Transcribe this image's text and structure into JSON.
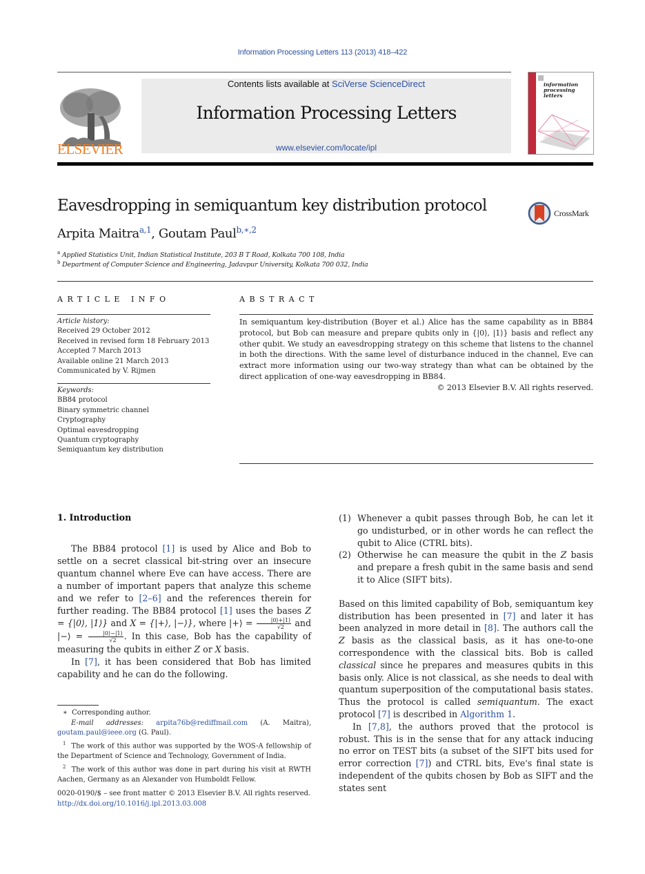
{
  "running_head": "Information Processing Letters 113 (2013) 418–422",
  "masthead": {
    "publisher": "ELSEVIER",
    "contents_prefix": "Contents lists available at ",
    "contents_link": "SciVerse ScienceDirect",
    "journal_title": "Information Processing Letters",
    "journal_url": "www.elsevier.com/locate/ipl",
    "cover_title_lines": [
      "information",
      "processing",
      "letters"
    ],
    "accent_color": "#f07f20",
    "cover_spine_color": "#c02a3b"
  },
  "article": {
    "title": "Eavesdropping in semiquantum key distribution protocol",
    "crossmark_label": "CrossMark",
    "authors": [
      {
        "name": "Arpita Maitra",
        "marks": "a,1"
      },
      {
        "name": "Goutam Paul",
        "marks": "b,∗,2"
      }
    ],
    "author_separator": ", ",
    "affiliations": [
      {
        "mark": "a",
        "text": "Applied Statistics Unit, Indian Statistical Institute, 203 B T Road, Kolkata 700 108, India"
      },
      {
        "mark": "b",
        "text": "Department of Computer Science and Engineering, Jadavpur University, Kolkata 700 032, India"
      }
    ]
  },
  "article_info": {
    "heading": "ARTICLE INFO",
    "history_label": "Article history:",
    "history": [
      "Received 29 October 2012",
      "Received in revised form 18 February 2013",
      "Accepted 7 March 2013",
      "Available online 21 March 2013",
      "Communicated by V. Rijmen"
    ],
    "keywords_label": "Keywords:",
    "keywords": [
      "BB84 protocol",
      "Binary symmetric channel",
      "Cryptography",
      "Optimal eavesdropping",
      "Quantum cryptography",
      "Semiquantum key distribution"
    ]
  },
  "abstract": {
    "heading": "ABSTRACT",
    "text": "In semiquantum key-distribution (Boyer et al.) Alice has the same capability as in BB84 protocol, but Bob can measure and prepare qubits only in {|0⟩, |1⟩} basis and reflect any other qubit. We study an eavesdropping strategy on this scheme that listens to the channel in both the directions. With the same level of disturbance induced in the channel, Eve can extract more information using our two-way strategy than what can be obtained by the direct application of one-way eavesdropping in BB84.",
    "copyright": "© 2013 Elsevier B.V. All rights reserved."
  },
  "intro": {
    "heading": "1. Introduction",
    "p1": {
      "a": "The BB84 protocol ",
      "ref1": "[1]",
      "b": " is used by Alice and Bob to settle on a secret classical bit-string over an insecure quantum channel where Eve can have access. There are a number of important papers that analyze this scheme and we refer to ",
      "ref2": "[2–6]",
      "c": " and the references therein for further reading. The BB84 protocol ",
      "ref3": "[1]",
      "d": " uses the bases ",
      "z_def": "Z = {|0⟩, |1⟩}",
      "e": " and ",
      "x_def": "X = {|+⟩, |−⟩}",
      "f": ", where |+⟩ = ",
      "frac1_num": "|0⟩+|1⟩",
      "frac_den": "√2",
      "g": " and |−⟩ = ",
      "frac2_num": "|0⟩−|1⟩",
      "h": ". In this case, Bob has the capability of measuring the qubits in either ",
      "z": "Z",
      "i": " or ",
      "x": "X",
      "j": " basis."
    },
    "p2": {
      "a": "In ",
      "ref": "[7]",
      "b": ", it has been considered that Bob has limited capability and he can do the following."
    },
    "list": [
      {
        "num": "(1)",
        "text": "Whenever a qubit passes through Bob, he can let it go undisturbed, or in other words he can reflect the qubit to Alice (CTRL bits)."
      },
      {
        "num": "(2)",
        "text_a": "Otherwise he can measure the qubit in the ",
        "z": "Z",
        "text_b": " basis and prepare a fresh qubit in the same basis and send it to Alice (SIFT bits)."
      }
    ],
    "p3": {
      "a": "Based on this limited capability of Bob, semiquantum key distribution has been presented in ",
      "ref1": "[7]",
      "b": " and later it has been analyzed in more detail in ",
      "ref2": "[8]",
      "c": ". The authors call the ",
      "z": "Z",
      "d": " basis as the classical basis, as it has one-to-one correspondence with the classical bits. Bob is called ",
      "classical": "classical",
      "e": " since he prepares and measures qubits in this basis only. Alice is not classical, as she needs to deal with quantum superposition of the computational basis states. Thus the protocol is called ",
      "semiquantum": "semiquantum",
      "f": ". The exact protocol ",
      "ref3": "[7]",
      "g": " is described in ",
      "alg": "Algorithm 1",
      "h": "."
    },
    "p4": {
      "a": "In ",
      "ref1": "[7,8]",
      "b": ", the authors proved that the protocol is robust. This is in the sense that for any attack inducing no error on TEST bits (a subset of the SIFT bits used for error correction ",
      "ref2": "[7]",
      "c": ") and CTRL bits, Eve's final state is independent of the qubits chosen by Bob as SIFT and the states sent"
    }
  },
  "footnotes": {
    "corresponding_mark": "∗",
    "corresponding": "Corresponding author.",
    "email_label": "E-mail addresses:",
    "email1": "arpita76b@rediffmail.com",
    "email1_owner": " (A. Maitra),",
    "email2": "goutam.paul@ieee.org",
    "email2_owner": " (G. Paul).",
    "fn1_mark": "1",
    "fn1": "The work of this author was supported by the WOS-A fellowship of the Department of Science and Technology, Government of India.",
    "fn2_mark": "2",
    "fn2": "The work of this author was done in part during his visit at RWTH Aachen, Germany as an Alexander von Humboldt Fellow."
  },
  "bottom": {
    "issn": "0020-0190/$ – see front matter  © 2013 Elsevier B.V. All rights reserved.",
    "doi": "http://dx.doi.org/10.1016/j.ipl.2013.03.008"
  }
}
